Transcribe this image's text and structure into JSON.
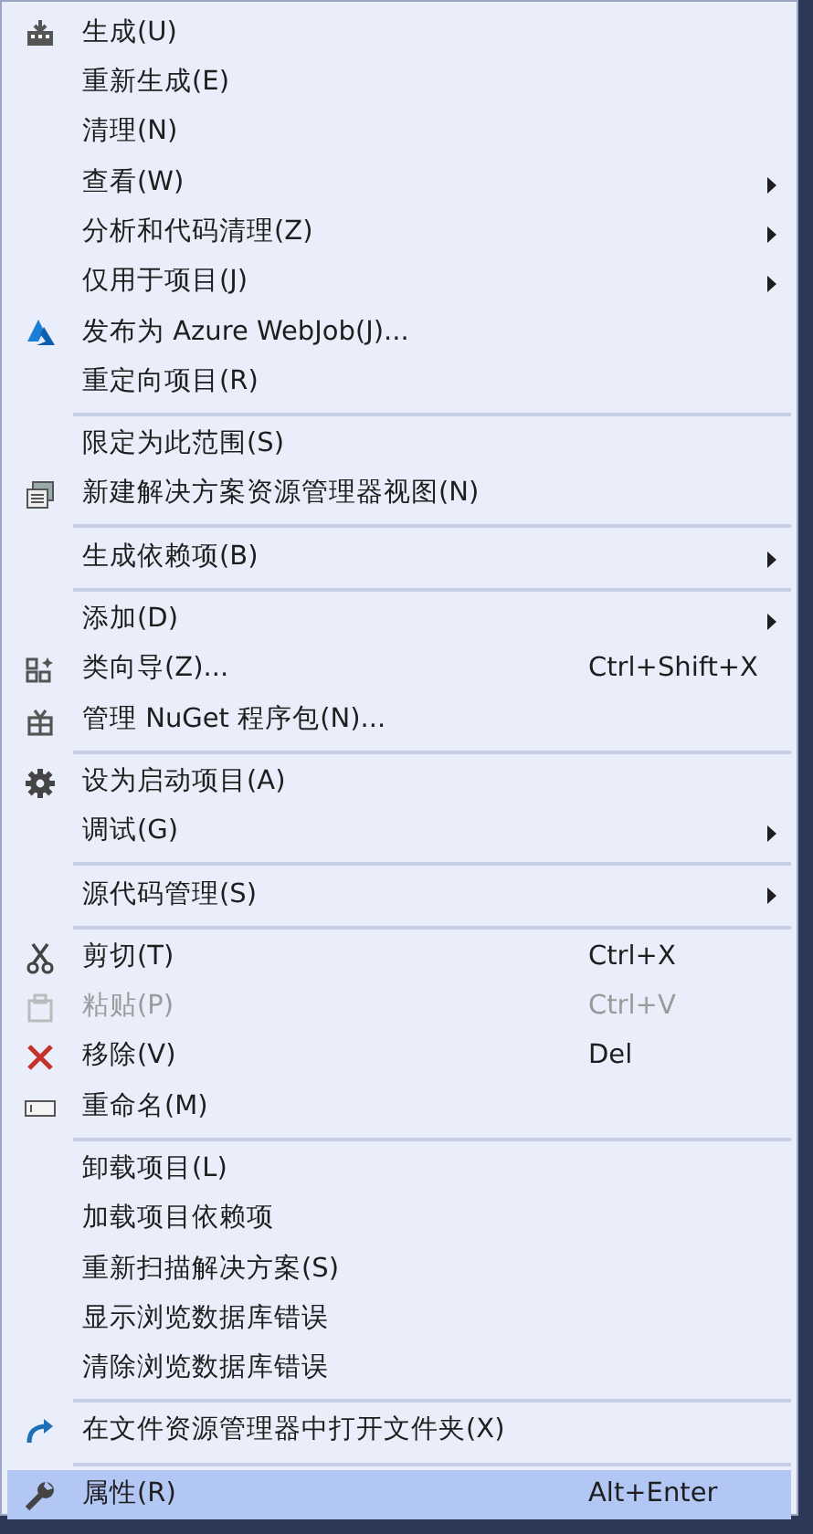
{
  "menu": {
    "groups": [
      {
        "items": [
          {
            "label": "生成(U)",
            "submenu": false,
            "disabled": false,
            "selected": false
          },
          {
            "label": "重新生成(E)",
            "submenu": false,
            "disabled": false,
            "selected": false
          },
          {
            "label": "清理(N)",
            "submenu": false,
            "disabled": false,
            "selected": false
          },
          {
            "label": "查看(W)",
            "submenu": true,
            "disabled": false,
            "selected": false
          },
          {
            "label": "分析和代码清理(Z)",
            "submenu": true,
            "disabled": false,
            "selected": false
          },
          {
            "label": "仅用于项目(J)",
            "submenu": true,
            "disabled": false,
            "selected": false
          },
          {
            "label": "发布为 Azure WebJob(J)...",
            "submenu": false,
            "disabled": false,
            "selected": false
          },
          {
            "label": "重定向项目(R)",
            "submenu": false,
            "disabled": false,
            "selected": false
          }
        ]
      },
      {
        "items": [
          {
            "label": "限定为此范围(S)",
            "submenu": false,
            "disabled": false,
            "selected": false
          },
          {
            "label": "新建解决方案资源管理器视图(N)",
            "submenu": false,
            "disabled": false,
            "selected": false
          }
        ]
      },
      {
        "items": [
          {
            "label": "生成依赖项(B)",
            "submenu": true,
            "disabled": false,
            "selected": false
          }
        ]
      },
      {
        "items": [
          {
            "label": "添加(D)",
            "submenu": true,
            "disabled": false,
            "selected": false
          },
          {
            "label": "类向导(Z)...",
            "shortcut": "Ctrl+Shift+X",
            "submenu": false,
            "disabled": false,
            "selected": false
          },
          {
            "label": "管理 NuGet 程序包(N)...",
            "submenu": false,
            "disabled": false,
            "selected": false
          }
        ]
      },
      {
        "items": [
          {
            "label": "设为启动项目(A)",
            "submenu": false,
            "disabled": false,
            "selected": false
          },
          {
            "label": "调试(G)",
            "submenu": true,
            "disabled": false,
            "selected": false
          }
        ]
      },
      {
        "items": [
          {
            "label": "源代码管理(S)",
            "submenu": true,
            "disabled": false,
            "selected": false
          }
        ]
      },
      {
        "items": [
          {
            "label": "剪切(T)",
            "shortcut": "Ctrl+X",
            "submenu": false,
            "disabled": false,
            "selected": false
          },
          {
            "label": "粘贴(P)",
            "shortcut": "Ctrl+V",
            "submenu": false,
            "disabled": true,
            "selected": false
          },
          {
            "label": "移除(V)",
            "shortcut": "Del",
            "submenu": false,
            "disabled": false,
            "selected": false
          },
          {
            "label": "重命名(M)",
            "submenu": false,
            "disabled": false,
            "selected": false
          }
        ]
      },
      {
        "items": [
          {
            "label": "卸载项目(L)",
            "submenu": false,
            "disabled": false,
            "selected": false
          },
          {
            "label": "加载项目依赖项",
            "submenu": false,
            "disabled": false,
            "selected": false
          },
          {
            "label": "重新扫描解决方案(S)",
            "submenu": false,
            "disabled": false,
            "selected": false
          },
          {
            "label": "显示浏览数据库错误",
            "submenu": false,
            "disabled": false,
            "selected": false
          },
          {
            "label": "清除浏览数据库错误",
            "submenu": false,
            "disabled": false,
            "selected": false
          }
        ]
      },
      {
        "items": [
          {
            "label": "在文件资源管理器中打开文件夹(X)",
            "submenu": false,
            "disabled": false,
            "selected": false
          }
        ]
      },
      {
        "items": [
          {
            "label": "属性(R)",
            "shortcut": "Alt+Enter",
            "submenu": false,
            "disabled": false,
            "selected": true
          }
        ]
      }
    ]
  }
}
